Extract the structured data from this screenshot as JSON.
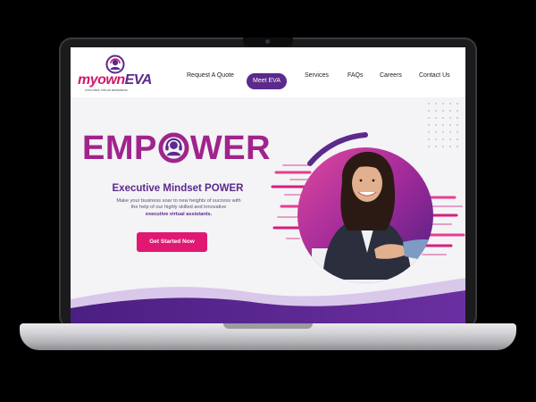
{
  "brand": {
    "logo_part1": "myown",
    "logo_part2": "EVA",
    "tagline": "executive virtual assistants"
  },
  "nav": {
    "items": [
      "Request A Quote",
      "Meet EVA",
      "Services",
      "FAQs",
      "Careers",
      "Contact Us"
    ],
    "active_index": 1
  },
  "hero": {
    "title_part1": "EMP",
    "title_part2": "WER",
    "subtitle": "Executive Mindset POWER",
    "description_line1": "Make your business soar to new heights of success with",
    "description_line2": "the help of our highly skilled and innovative",
    "description_bold": "executive virtual assistants.",
    "cta": "Get Started Now"
  },
  "colors": {
    "primary_purple": "#5b2a8c",
    "magenta": "#a0248c",
    "pink": "#e01872",
    "screen_bg": "#f4f3f6"
  }
}
